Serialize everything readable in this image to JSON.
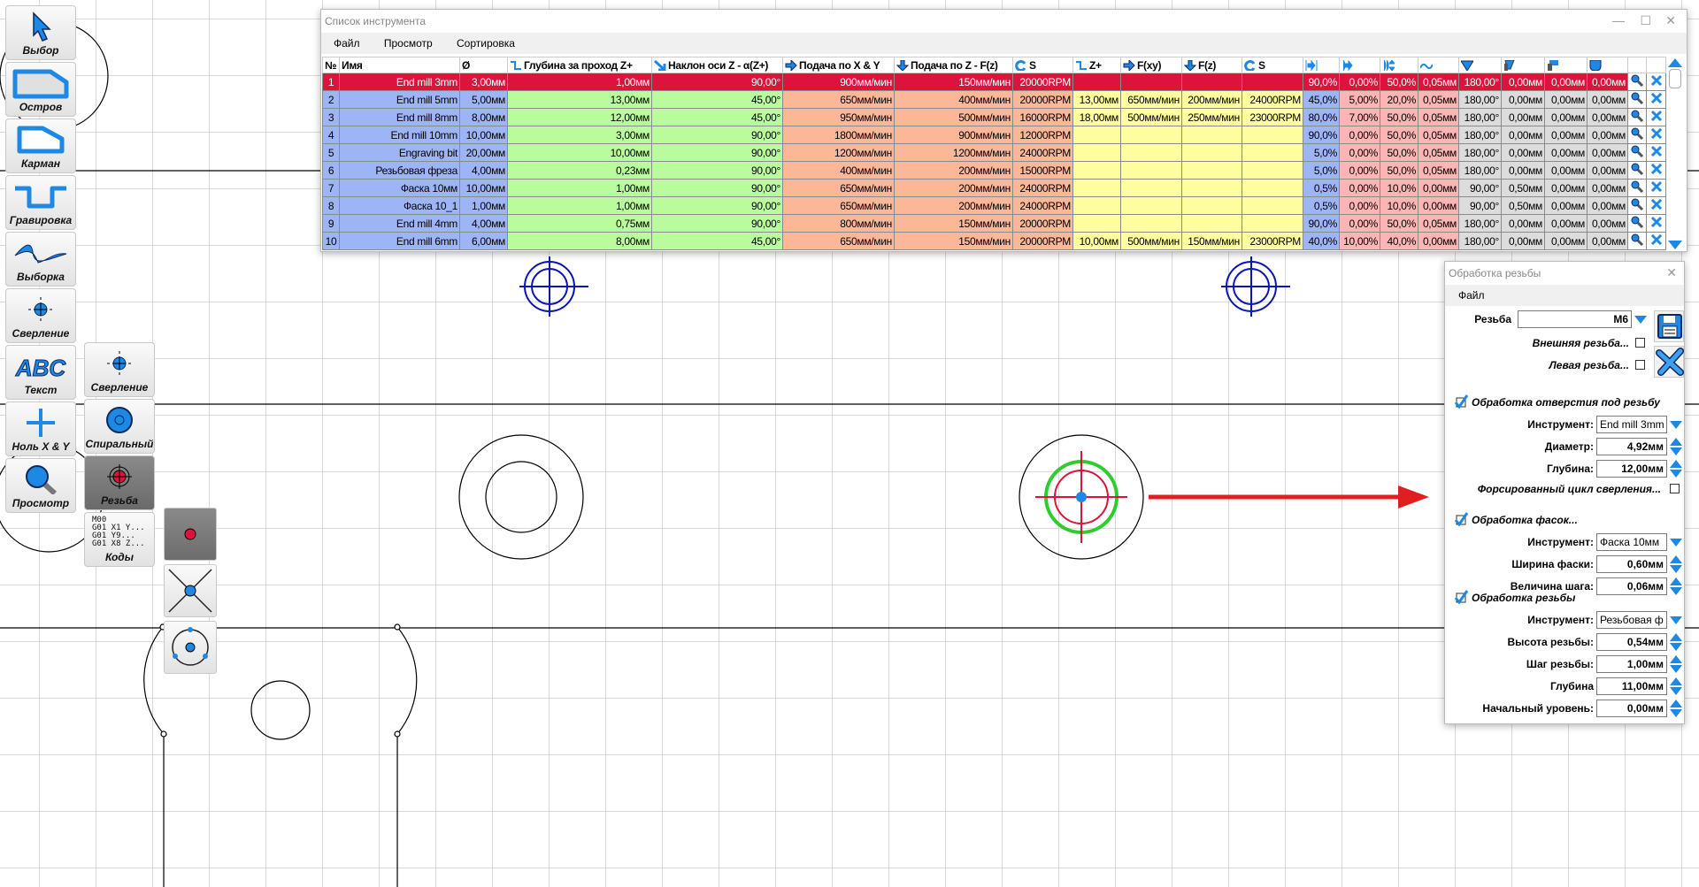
{
  "toolbar": {
    "main": [
      {
        "label": "Выбор",
        "icon": "cursor-icon"
      },
      {
        "label": "Остров",
        "icon": "island-icon"
      },
      {
        "label": "Карман",
        "icon": "pocket-icon"
      },
      {
        "label": "Гравировка",
        "icon": "engraving-icon"
      },
      {
        "label": "Выборка",
        "icon": "sampling-icon"
      },
      {
        "label": "Сверление",
        "icon": "drilling-icon"
      },
      {
        "label": "Текст",
        "icon": "text-icon",
        "glyph": "ABC"
      },
      {
        "label": "Ноль X & Y",
        "icon": "zero-xy-icon"
      },
      {
        "label": "Просмотр",
        "icon": "magnifier-icon"
      }
    ],
    "drilling_sub": [
      {
        "label": "Сверление",
        "icon": "drilling-icon"
      },
      {
        "label": "Спиральный",
        "icon": "spiral-icon"
      },
      {
        "label": "Резьба",
        "icon": "thread-icon",
        "active": true
      },
      {
        "label": "Коды",
        "icon": "gcode-icon",
        "code_lines": [
          "M00",
          "G01 X1 Y...",
          "G01 Y9...",
          "G01 X8 Z..."
        ]
      }
    ],
    "small": [
      "point-icon",
      "cross-icon",
      "circle-points-icon"
    ]
  },
  "tool_list": {
    "title": "Список инструмента",
    "menu": [
      "Файл",
      "Просмотр",
      "Сортировка"
    ],
    "columns": [
      "№",
      "Имя",
      "Ø",
      "Глубина за проход Z+",
      "Наклон оси Z - α(Z+)",
      "Подача по X & Y",
      "Подача по Z - F(z)",
      "S",
      "Z+",
      "F(xy)",
      "F(z)",
      "S",
      "",
      "",
      "",
      "",
      "",
      "",
      "",
      "",
      "",
      ""
    ],
    "rows": [
      [
        "1",
        "End mill 3mm",
        "3,00мм",
        "1,00мм",
        "90,00°",
        "900мм/мин",
        "150мм/мин",
        "20000RPM",
        "",
        "",
        "",
        "",
        "90,0%",
        "0,00%",
        "50,0%",
        "0,05мм",
        "180,00°",
        "0,00мм",
        "0,00мм",
        "0,00мм"
      ],
      [
        "2",
        "End mill 5mm",
        "5,00мм",
        "13,00мм",
        "45,00°",
        "650мм/мин",
        "400мм/мин",
        "20000RPM",
        "13,00мм",
        "650мм/мин",
        "200мм/мин",
        "24000RPM",
        "45,0%",
        "5,00%",
        "20,0%",
        "0,05мм",
        "180,00°",
        "0,00мм",
        "0,00мм",
        "0,00мм"
      ],
      [
        "3",
        "End mill 8mm",
        "8,00мм",
        "12,00мм",
        "45,00°",
        "950мм/мин",
        "500мм/мин",
        "16000RPM",
        "18,00мм",
        "500мм/мин",
        "250мм/мин",
        "23000RPM",
        "80,0%",
        "7,00%",
        "50,0%",
        "0,05мм",
        "180,00°",
        "0,00мм",
        "0,00мм",
        "0,00мм"
      ],
      [
        "4",
        "End mill 10mm",
        "10,00мм",
        "3,00мм",
        "90,00°",
        "1800мм/мин",
        "900мм/мин",
        "12000RPM",
        "",
        "",
        "",
        "",
        "90,0%",
        "0,00%",
        "50,0%",
        "0,05мм",
        "180,00°",
        "0,00мм",
        "0,00мм",
        "0,00мм"
      ],
      [
        "5",
        "Engraving bit",
        "20,00мм",
        "10,00мм",
        "90,00°",
        "1200мм/мин",
        "1200мм/мин",
        "24000RPM",
        "",
        "",
        "",
        "",
        "5,0%",
        "0,00%",
        "50,0%",
        "0,05мм",
        "180,00°",
        "0,00мм",
        "0,00мм",
        "0,00мм"
      ],
      [
        "6",
        "Резьбовая фреза",
        "4,00мм",
        "0,23мм",
        "90,00°",
        "400мм/мин",
        "200мм/мин",
        "15000RPM",
        "",
        "",
        "",
        "",
        "5,0%",
        "0,00%",
        "50,0%",
        "0,05мм",
        "180,00°",
        "0,00мм",
        "0,00мм",
        "0,00мм"
      ],
      [
        "7",
        "Фаска 10мм",
        "10,00мм",
        "1,00мм",
        "90,00°",
        "650мм/мин",
        "200мм/мин",
        "24000RPM",
        "",
        "",
        "",
        "",
        "0,5%",
        "0,00%",
        "10,0%",
        "0,00мм",
        "90,00°",
        "0,50мм",
        "0,00мм",
        "0,00мм"
      ],
      [
        "8",
        "Фаска 10_1",
        "1,00мм",
        "1,00мм",
        "90,00°",
        "650мм/мин",
        "200мм/мин",
        "24000RPM",
        "",
        "",
        "",
        "",
        "0,5%",
        "0,00%",
        "10,0%",
        "0,00мм",
        "90,00°",
        "0,50мм",
        "0,00мм",
        "0,00мм"
      ],
      [
        "9",
        "End mill 4mm",
        "4,00мм",
        "0,75мм",
        "90,00°",
        "800мм/мин",
        "150мм/мин",
        "20000RPM",
        "",
        "",
        "",
        "",
        "90,0%",
        "0,00%",
        "50,0%",
        "0,05мм",
        "180,00°",
        "0,00мм",
        "0,00мм",
        "0,00мм"
      ],
      [
        "10",
        "End mill 6mm",
        "6,00мм",
        "8,00мм",
        "45,00°",
        "650мм/мин",
        "150мм/мин",
        "20000RPM",
        "10,00мм",
        "500мм/мин",
        "150мм/мин",
        "23000RPM",
        "40,0%",
        "10,00%",
        "40,0%",
        "0,00мм",
        "180,00°",
        "0,00мм",
        "0,00мм",
        "0,00мм"
      ]
    ],
    "selected_row": 0,
    "colors": {
      "selected": "#dc143c",
      "blue": "#9db4f7",
      "green": "#bafc9b",
      "orange": "#fcb698",
      "yellow": "#fefe9e",
      "pink": "#fcb4b4",
      "grey": "#dcdcdc"
    }
  },
  "thread_panel": {
    "title": "Обработка резьбы",
    "menu": [
      "Файл"
    ],
    "thread_label": "Резьба",
    "thread_value": "M6",
    "external_label": "Внешняя резьба...",
    "external_checked": false,
    "left_label": "Левая резьба...",
    "left_checked": false,
    "hole": {
      "title": "Обработка отверстия под резьбу",
      "checked": true,
      "tool_label": "Инструмент:",
      "tool_value": "End mill 3mm",
      "diameter_label": "Диаметр:",
      "diameter_value": "4,92мм",
      "depth_label": "Глубина:",
      "depth_value": "12,00мм",
      "forced_label": "Форсированный цикл сверления...",
      "forced_checked": false
    },
    "chamfer": {
      "title": "Обработка фасок...",
      "checked": true,
      "tool_label": "Инструмент:",
      "tool_value": "Фаска 10мм",
      "width_label": "Ширина фаски:",
      "width_value": "0,60мм",
      "step_label": "Величина шага:",
      "step_value": "0,06мм"
    },
    "thread": {
      "title": "Обработка резьбы",
      "checked": true,
      "tool_label": "Инструмент:",
      "tool_value": "Резьбовая ф",
      "height_label": "Высота резьбы:",
      "height_value": "0,54мм",
      "pitch_label": "Шаг резьбы:",
      "pitch_value": "1,00мм",
      "depth_label": "Глубина",
      "depth_value": "11,00мм",
      "start_label": "Начальный уровень:",
      "start_value": "0,00мм"
    }
  }
}
